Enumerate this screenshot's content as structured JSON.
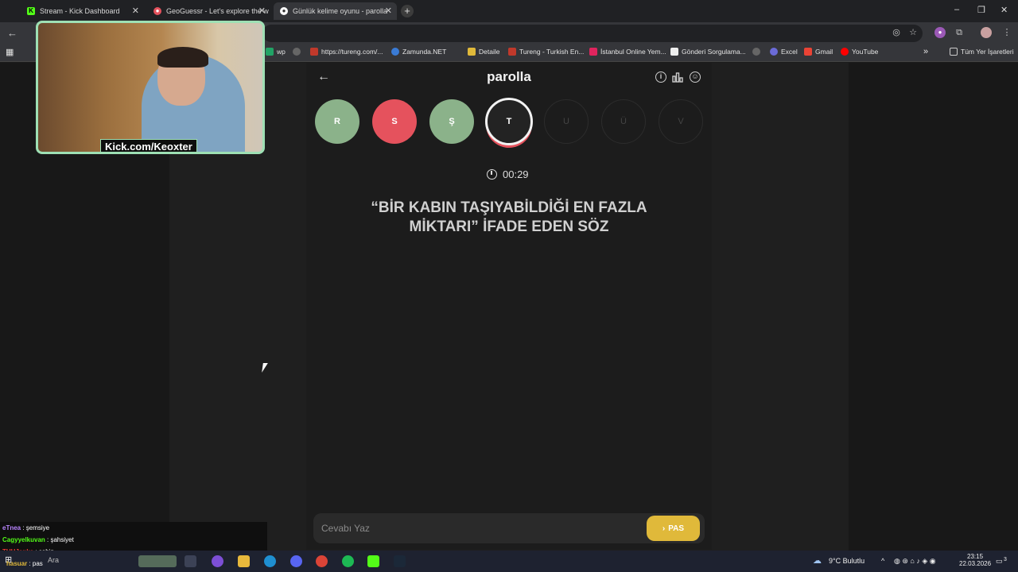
{
  "browser": {
    "tabs": [
      {
        "title": "Stream - Kick Dashboard",
        "fav_color": "#53fc18",
        "fav_glyph": "K"
      },
      {
        "title": "GeoGuessr - Let's explore the w",
        "fav_color": "#e5525d",
        "fav_glyph": "●"
      },
      {
        "title": "Günlük kelime oyunu - parolla",
        "fav_color": "#ffffff",
        "fav_glyph": "●",
        "active": true
      }
    ],
    "new_tab": "+",
    "window_controls": {
      "min": "–",
      "max": "❐",
      "close": "✕"
    },
    "bookmarks": [
      {
        "label": "wp",
        "color": "#21a366",
        "glyph": "w"
      },
      {
        "label": "",
        "color": "#888888",
        "glyph": "◍"
      },
      {
        "label": "https://tureng.com/...",
        "color": "#c0392b",
        "glyph": "t"
      },
      {
        "label": "Zamunda.NET",
        "color": "#3a7bd5",
        "glyph": "Z"
      },
      {
        "label": "Detaile",
        "color": "#e0b93a",
        "glyph": "D"
      },
      {
        "label": "Tureng - Turkish En...",
        "color": "#c0392b",
        "glyph": "t"
      },
      {
        "label": "İstanbul Online Yem...",
        "color": "#e0245e",
        "glyph": "Y"
      },
      {
        "label": "Gönderi Sorgulama...",
        "color": "#ffffff",
        "glyph": "K"
      },
      {
        "label": "",
        "color": "#888888",
        "glyph": "◍"
      },
      {
        "label": "Excel",
        "color": "#6b6bd8",
        "glyph": "E"
      },
      {
        "label": "Gmail",
        "color": "#ea4335",
        "glyph": "M"
      },
      {
        "label": "YouTube",
        "color": "#ff0000",
        "glyph": "▶"
      }
    ],
    "bookmarks_more": "»",
    "all_bookmarks": "Tüm Yer İşaretleri"
  },
  "game": {
    "brand": "parolla",
    "letters": [
      {
        "char": "R",
        "state": "correct"
      },
      {
        "char": "S",
        "state": "wrong"
      },
      {
        "char": "Ş",
        "state": "correct"
      },
      {
        "char": "T",
        "state": "current"
      },
      {
        "char": "U",
        "state": "pending"
      },
      {
        "char": "Ü",
        "state": "pending"
      },
      {
        "char": "V",
        "state": "pending"
      }
    ],
    "timer": "00:29",
    "question": "“BİR KABIN TAŞIYABİLDİĞİ EN FAZLA MİKTARI” İFADE EDEN SÖZ",
    "answer_placeholder": "Cevabı Yaz",
    "pass_label": "PAS",
    "colors": {
      "correct": "#8bb28a",
      "wrong": "#e5525d",
      "pass": "#e0b93a"
    }
  },
  "webcam": {
    "label": "Kick.com/Keoxter"
  },
  "chat": [
    {
      "user": "eTnea",
      "user_color": "#b884ff",
      "message": " : şemsiye"
    },
    {
      "user": "Cagyyelkuvan",
      "user_color": "#53fc18",
      "message": " : şahsiyet"
    },
    {
      "user": "TUHJanks",
      "user_color": "#e53935",
      "message": " : şahin"
    },
    {
      "user": "hasuar",
      "user_color": "#e0b93a",
      "message": " : pas"
    }
  ],
  "taskbar": {
    "search": "Ara",
    "weather": "9°C  Bulutlu",
    "time": "23:15",
    "date": "22.03.2026",
    "notif_count": "3"
  }
}
